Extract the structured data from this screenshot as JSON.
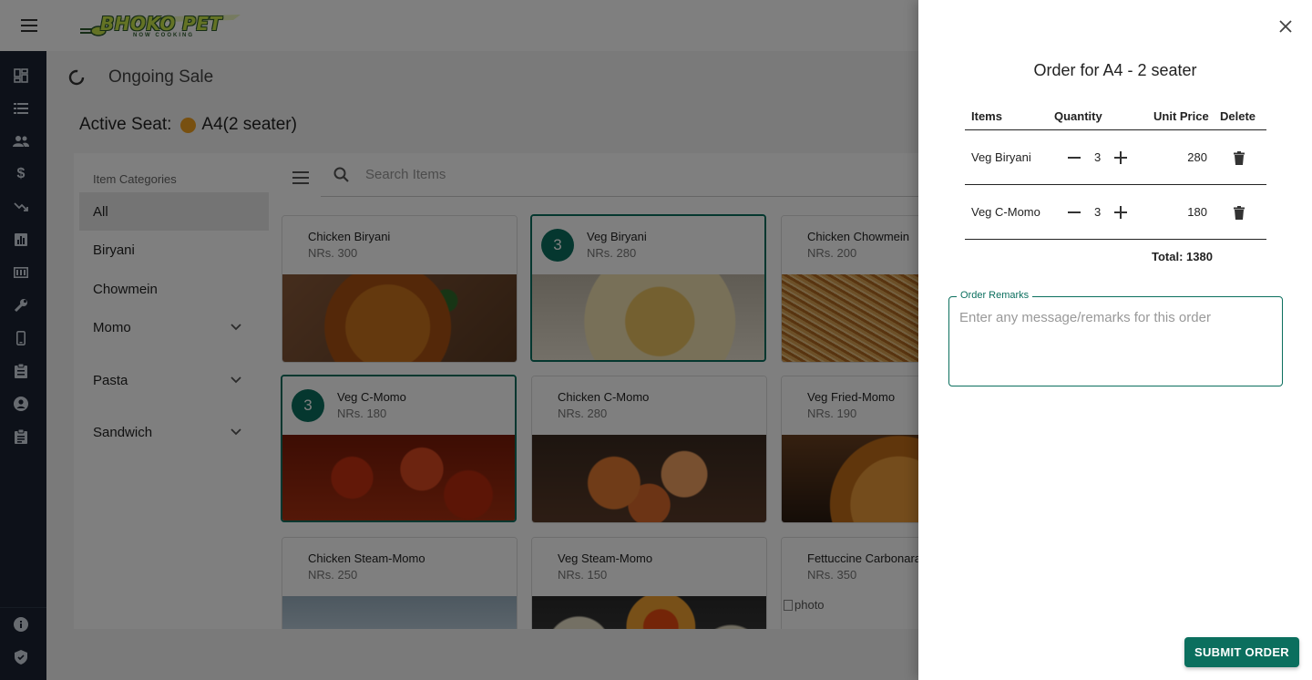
{
  "header": {
    "logo_text": "BHOKO PET",
    "logo_sub": "NOW COOKING"
  },
  "rail": {
    "icons": [
      "dashboard-icon",
      "list-icon",
      "people-icon",
      "dollar-icon",
      "trending-down-icon",
      "bar-chart-icon",
      "receipt-icon",
      "wrench-icon",
      "phone-icon",
      "clipboard-icon",
      "account-icon",
      "assignment-icon"
    ],
    "bottom_icons": [
      "info-icon",
      "shield-icon"
    ]
  },
  "page": {
    "title": "Ongoing Sale",
    "seat_label": "Active Seat:",
    "seat_value": "A4(2 seater)"
  },
  "categories": {
    "title": "Item Categories",
    "items": [
      {
        "label": "All",
        "expandable": false,
        "active": true
      },
      {
        "label": "Biryani",
        "expandable": false,
        "active": false
      },
      {
        "label": "Chowmein",
        "expandable": false,
        "active": false
      },
      {
        "label": "Momo",
        "expandable": true,
        "active": false
      },
      {
        "label": "Pasta",
        "expandable": true,
        "active": false
      },
      {
        "label": "Sandwich",
        "expandable": true,
        "active": false
      }
    ]
  },
  "search": {
    "placeholder": "Search Items"
  },
  "items": [
    {
      "name": "Chicken Biryani",
      "price": "NRs. 300",
      "qty": null,
      "img": "biryani1"
    },
    {
      "name": "Veg Biryani",
      "price": "NRs. 280",
      "qty": "3",
      "img": "biryani2"
    },
    {
      "name": "Chicken Chowmein",
      "price": "NRs. 200",
      "qty": null,
      "img": "chowmein"
    },
    {
      "name": "Veg C-Momo",
      "price": "NRs. 180",
      "qty": "3",
      "img": "cmomo"
    },
    {
      "name": "Chicken C-Momo",
      "price": "NRs. 280",
      "qty": null,
      "img": "cmomo2"
    },
    {
      "name": "Veg Fried-Momo",
      "price": "NRs. 190",
      "qty": null,
      "img": "fried"
    },
    {
      "name": "Chicken Steam-Momo",
      "price": "NRs. 250",
      "qty": null,
      "img": "steam"
    },
    {
      "name": "Veg Steam-Momo",
      "price": "NRs. 150",
      "qty": null,
      "img": "steam2"
    },
    {
      "name": "Fettuccine Carbonara",
      "price": "NRs. 350",
      "qty": null,
      "img": "broken",
      "img_alt": "photo"
    }
  ],
  "drawer": {
    "title": "Order for A4 - 2 seater",
    "columns": {
      "items": "Items",
      "quantity": "Quantity",
      "unit_price": "Unit Price",
      "delete": "Delete"
    },
    "rows": [
      {
        "item": "Veg Biryani",
        "qty": "3",
        "price": "280"
      },
      {
        "item": "Veg C-Momo",
        "qty": "3",
        "price": "180"
      }
    ],
    "total": "Total: 1380",
    "remarks_label": "Order Remarks",
    "remarks_placeholder": "Enter any message/remarks for this order",
    "remarks_value": "",
    "submit_label": "SUBMIT ORDER"
  },
  "colors": {
    "accent": "#0b6f5e",
    "rail": "#1a2332",
    "seat_badge": "#f0a020"
  }
}
